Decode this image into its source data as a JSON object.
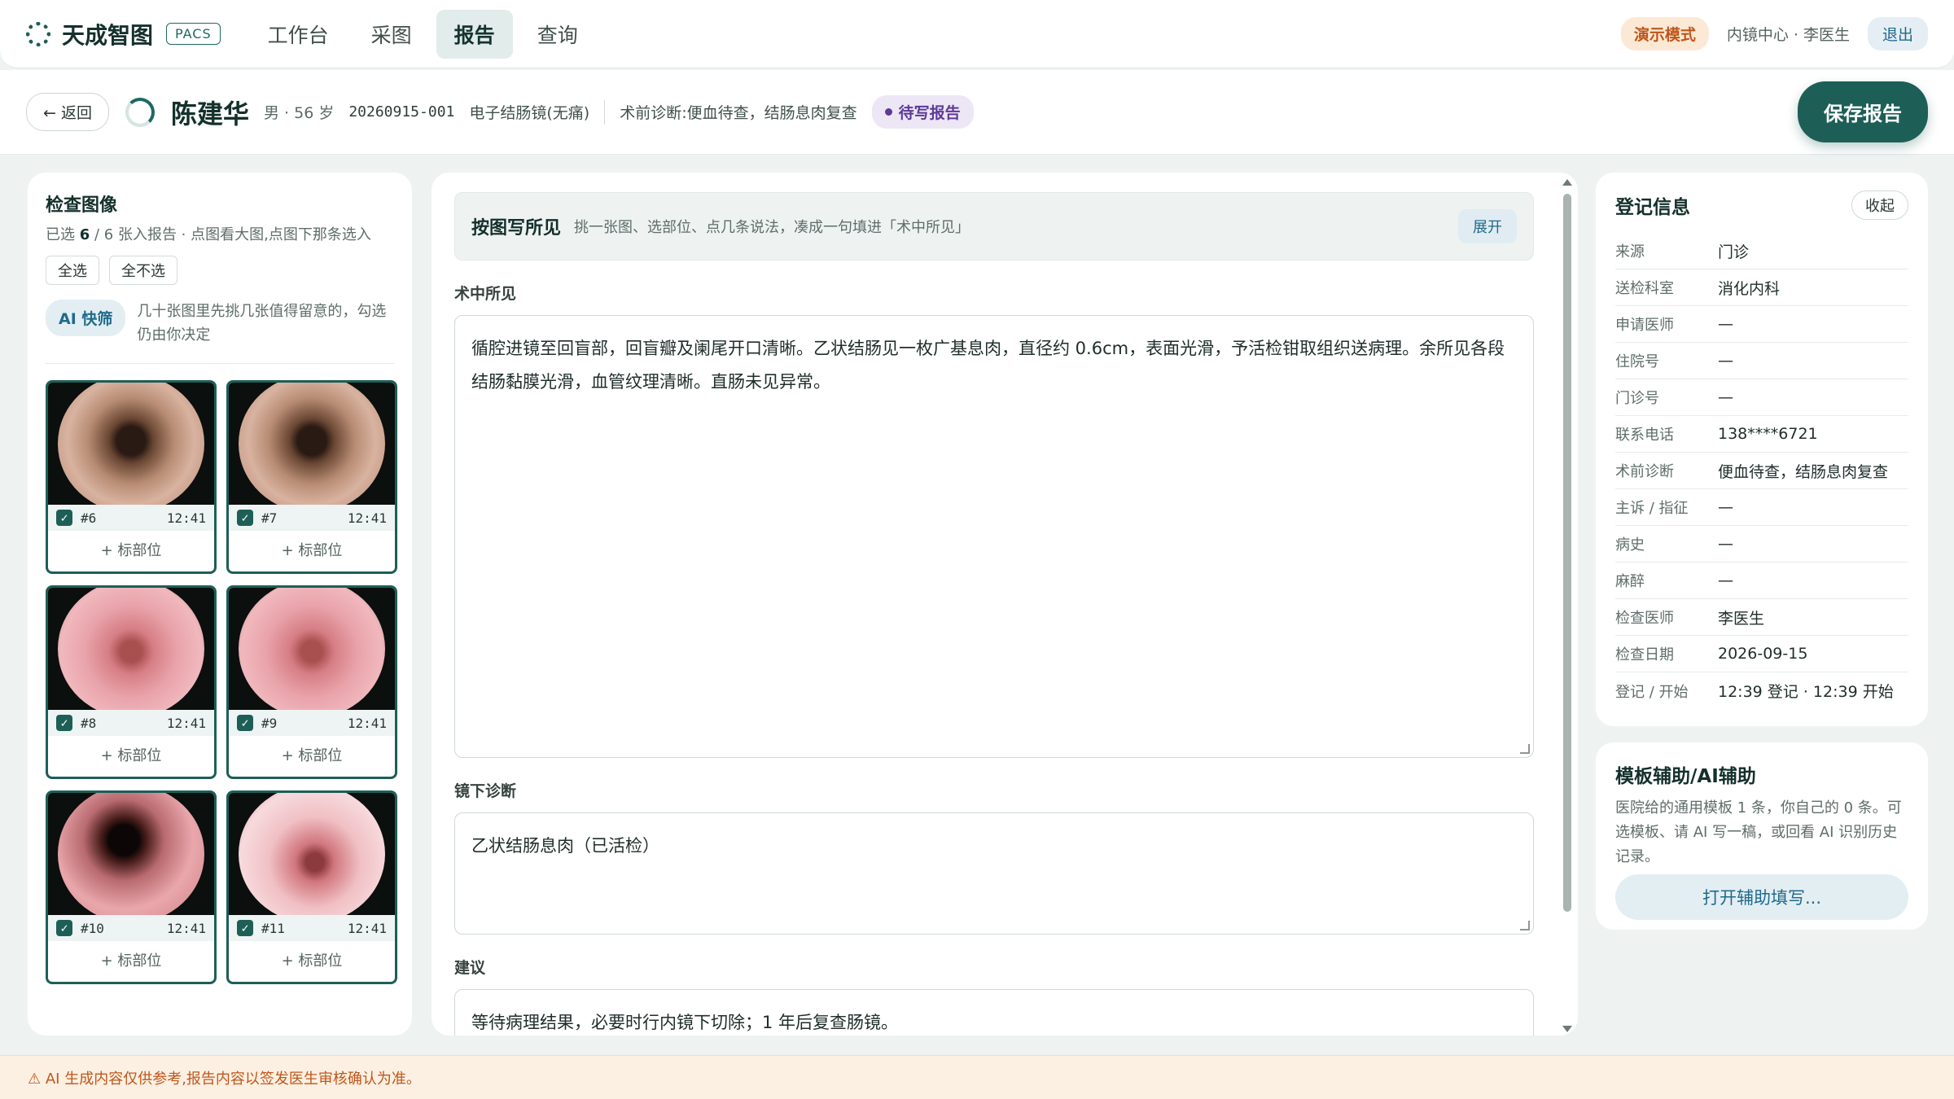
{
  "nav": {
    "brand": "天成智图",
    "badge": "PACS",
    "items": [
      {
        "label": "工作台",
        "active": false
      },
      {
        "label": "采图",
        "active": false
      },
      {
        "label": "报告",
        "active": true
      },
      {
        "label": "查询",
        "active": false
      }
    ],
    "demo_mode": "演示模式",
    "user": "内镜中心 · 李医生",
    "logout": "退出"
  },
  "patient": {
    "back": "← 返回",
    "name": "陈建华",
    "meta": "男 · 56 岁",
    "exam_id": "20260915-001",
    "exam_type": "电子结肠镜(无痛)",
    "pre_diagnosis": "术前诊断:便血待查，结肠息肉复查",
    "status": "待写报告",
    "save": "保存报告"
  },
  "images_panel": {
    "title": "检查图像",
    "subtitle_prefix": "已选 ",
    "selected": "6",
    "subtitle_suffix": " / 6 张入报告 · 点图看大图,点图下那条选入",
    "select_all": "全选",
    "select_none": "全不选",
    "ai_button": "AI 快筛",
    "ai_desc": "几十张图里先挑几张值得留意的，勾选仍由你决定",
    "tag_label": "+ 标部位",
    "thumbs": [
      {
        "num": "#6",
        "time": "12:41",
        "style": "tan"
      },
      {
        "num": "#7",
        "time": "12:41",
        "style": "tan"
      },
      {
        "num": "#8",
        "time": "12:41",
        "style": "pink"
      },
      {
        "num": "#9",
        "time": "12:41",
        "style": "pink"
      },
      {
        "num": "#10",
        "time": "12:41",
        "style": "dark"
      },
      {
        "num": "#11",
        "time": "12:41",
        "style": "light"
      }
    ]
  },
  "report": {
    "hint_title": "按图写所见",
    "hint_text": "挑一张图、选部位、点几条说法，凑成一句填进「术中所见」",
    "expand": "展开",
    "findings_label": "术中所见",
    "findings": "循腔进镜至回盲部，回盲瓣及阑尾开口清晰。乙状结肠见一枚广基息肉，直径约 0.6cm，表面光滑，予活检钳取组织送病理。余所见各段结肠黏膜光滑，血管纹理清晰。直肠未见异常。",
    "diagnosis_label": "镜下诊断",
    "diagnosis": "乙状结肠息肉（已活检）",
    "advice_label": "建议",
    "advice": "等待病理结果，必要时行内镜下切除；1 年后复查肠镜。"
  },
  "registration": {
    "title": "登记信息",
    "collapse": "收起",
    "rows": [
      {
        "k": "来源",
        "v": "门诊"
      },
      {
        "k": "送检科室",
        "v": "消化内科"
      },
      {
        "k": "申请医师",
        "v": "—"
      },
      {
        "k": "住院号",
        "v": "—"
      },
      {
        "k": "门诊号",
        "v": "—"
      },
      {
        "k": "联系电话",
        "v": "138****6721"
      },
      {
        "k": "术前诊断",
        "v": "便血待查，结肠息肉复查"
      },
      {
        "k": "主诉 / 指征",
        "v": "—"
      },
      {
        "k": "病史",
        "v": "—"
      },
      {
        "k": "麻醉",
        "v": "—"
      },
      {
        "k": "检查医师",
        "v": "李医生"
      },
      {
        "k": "检查日期",
        "v": "2026-09-15"
      },
      {
        "k": "登记 / 开始",
        "v": "12:39 登记 · 12:39 开始"
      }
    ]
  },
  "assist": {
    "title": "模板辅助/AI辅助",
    "desc": "医院给的通用模板 1 条，你自己的 0 条。可选模板、请 AI 写一稿，或回看 AI 识别历史记录。",
    "open": "打开辅助填写..."
  },
  "footer": "⚠ AI 生成内容仅供参考,报告内容以签发医生审核确认为准。"
}
